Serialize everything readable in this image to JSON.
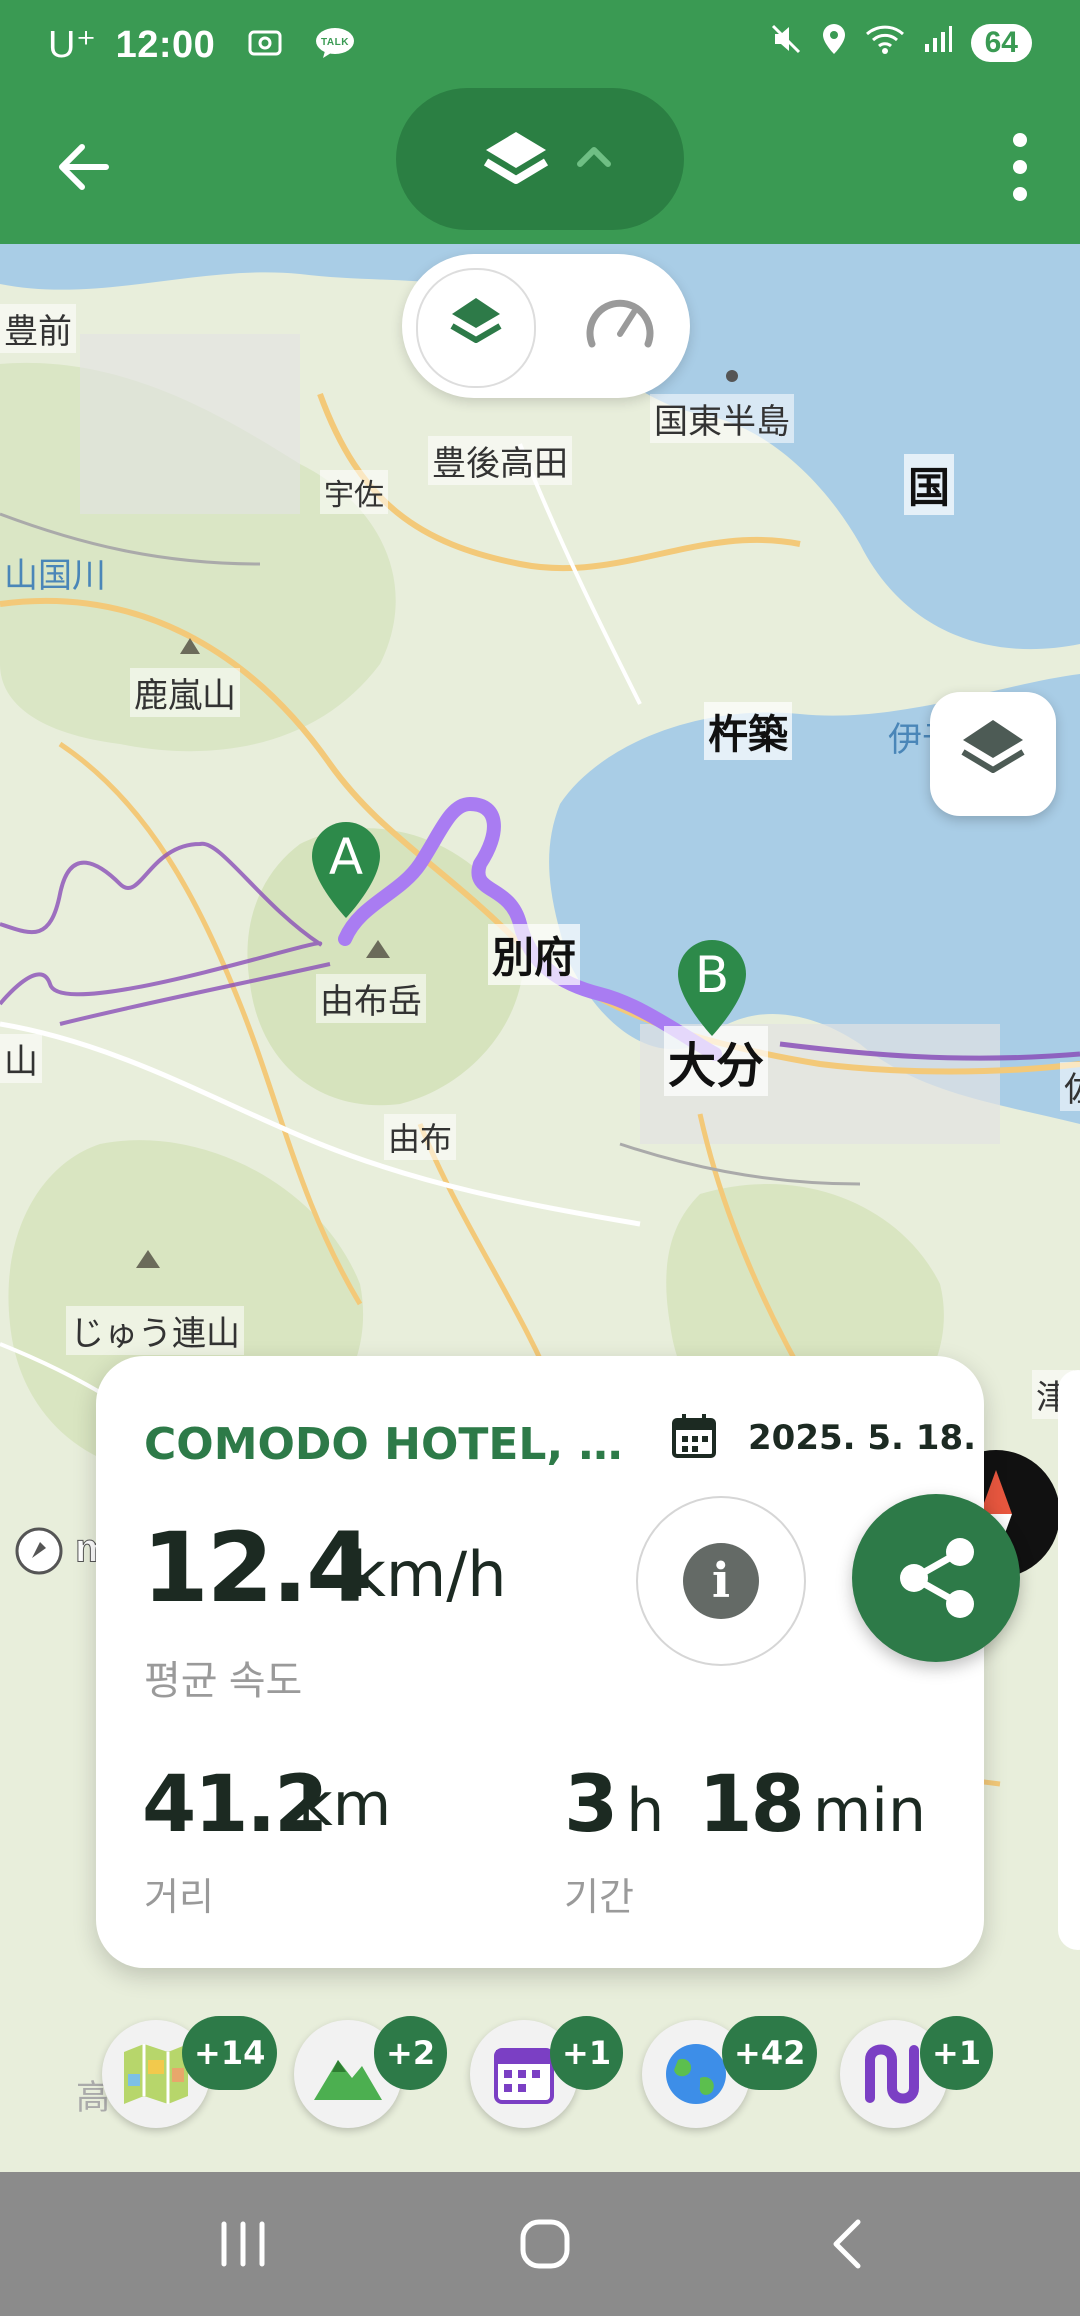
{
  "status_bar": {
    "carrier": "U⁺",
    "time": "12:00",
    "talk_badge": "TALK",
    "battery": "64"
  },
  "map": {
    "labels": {
      "bungo_mae": "豊前",
      "kunisaki": "国東半島",
      "bungo_takada": "豊後高田",
      "usa": "宇佐",
      "kuni_partial": "国",
      "yamakuni": "山国川",
      "karasuyama": "鹿嵐山",
      "kitsuki": "杵築",
      "iyonada": "伊予灘",
      "beppu": "別府",
      "yufudake": "由布岳",
      "oita": "大分",
      "yufu": "由布",
      "yama_left": "山",
      "tsu": "津",
      "renzan": "じゅう連山",
      "taka": "高",
      "sa_right": "佐"
    },
    "markers": {
      "start": "A",
      "end": "B"
    },
    "attribution": "mapbox"
  },
  "card": {
    "title": "COMODO HOTEL, 大分...",
    "date": "2025. 5. 18.",
    "avg_speed": "12.4",
    "avg_speed_unit": "km/h",
    "avg_speed_label": "평균 속도",
    "distance": "41.2",
    "distance_unit": "km",
    "distance_label": "거리",
    "duration_h": "3",
    "duration_h_unit": "h",
    "duration_m": "18",
    "duration_m_unit": "min",
    "duration_label": "기간"
  },
  "badges": [
    {
      "name": "map-badge",
      "count": "+14"
    },
    {
      "name": "mountain-badge",
      "count": "+2"
    },
    {
      "name": "calendar-badge",
      "count": "+1"
    },
    {
      "name": "globe-badge",
      "count": "+42"
    },
    {
      "name": "route-badge",
      "count": "+1"
    }
  ],
  "colors": {
    "app_green": "#3a9a53",
    "dark_green": "#2d7a48",
    "route_purple": "#a97cf2"
  }
}
